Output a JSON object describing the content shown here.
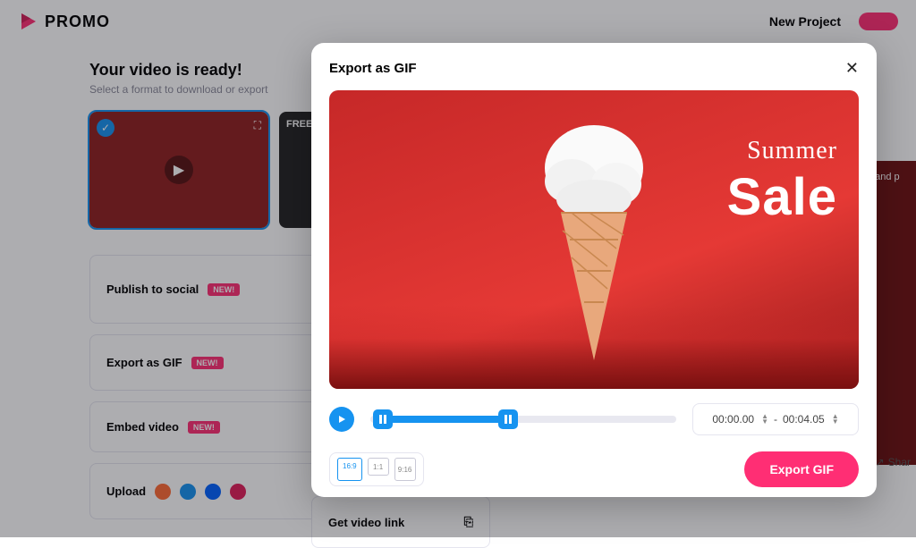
{
  "brand": "PROMO",
  "topbar": {
    "new_project": "New Project"
  },
  "page": {
    "title": "Your video is ready!",
    "subtitle": "Select a format to download or export",
    "free_label": "FREE"
  },
  "cards": {
    "publish": {
      "label": "Publish to social",
      "badge": "NEW!"
    },
    "gif": {
      "label": "Export as GIF",
      "badge": "NEW!"
    },
    "embed": {
      "label": "Embed video",
      "badge": "NEW!"
    },
    "upload": {
      "label": "Upload"
    },
    "getlink": {
      "label": "Get video link"
    }
  },
  "rightpane": {
    "hint": "t and p",
    "share": "Shar"
  },
  "modal": {
    "title": "Export as GIF",
    "preview": {
      "line1": "Summer",
      "line2": "Sale"
    },
    "time": {
      "start": "00:00.00",
      "sep": "-",
      "end": "00:04.05"
    },
    "ratios": {
      "wide": "16:9",
      "square": "1:1",
      "portrait": "9:16"
    },
    "export_label": "Export GIF"
  }
}
